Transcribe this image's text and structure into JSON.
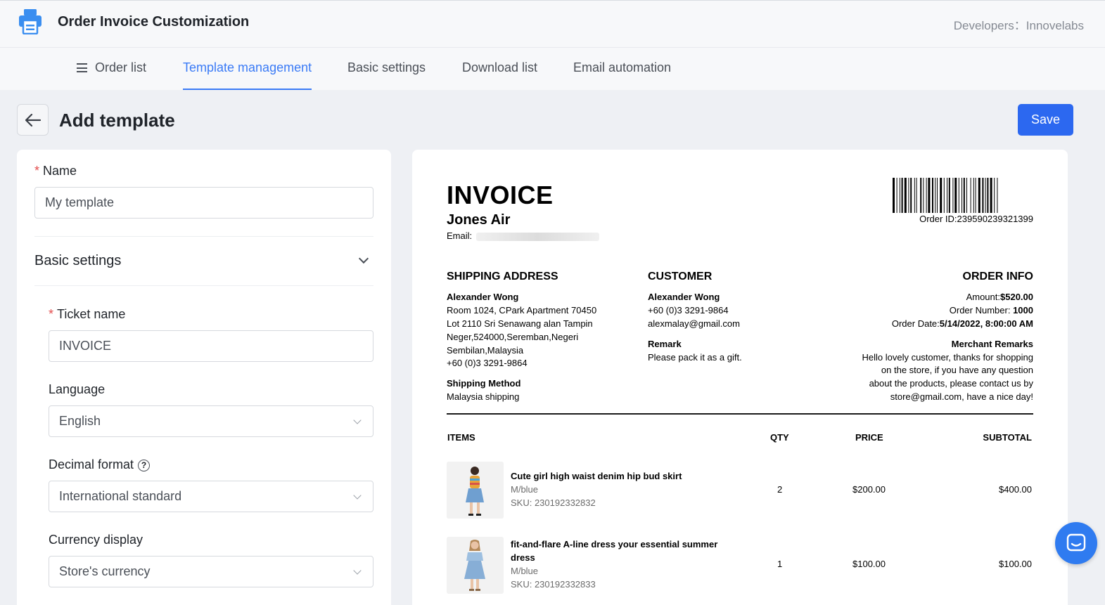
{
  "app": {
    "title": "Order Invoice Customization",
    "developer": "Developers：Innovelabs"
  },
  "nav": {
    "items": [
      {
        "label": "Order list"
      },
      {
        "label": "Template management"
      },
      {
        "label": "Basic settings"
      },
      {
        "label": "Download list"
      },
      {
        "label": "Email automation"
      }
    ],
    "active": "Template management"
  },
  "page": {
    "title": "Add template",
    "save_label": "Save"
  },
  "form": {
    "name_label": "Name",
    "name_value": "My template",
    "basic_settings_title": "Basic settings",
    "ticket_name_label": "Ticket name",
    "ticket_name_value": "INVOICE",
    "language_label": "Language",
    "language_value": "English",
    "decimal_label": "Decimal format",
    "decimal_value": "International standard",
    "currency_label": "Currency display",
    "currency_value": "Store's currency"
  },
  "invoice": {
    "title": "INVOICE",
    "company": "Jones Air",
    "email_label": "Email:",
    "order_id": "Order ID:239590239321399",
    "shipping": {
      "heading": "SHIPPING ADDRESS",
      "name": "Alexander Wong",
      "line1": "Room 1024, CPark Apartment 70450",
      "line2": "Lot 2110 Sri Senawang alan Tampin",
      "line3": "Neger,524000,Seremban,Negeri",
      "line4": "Sembilan,Malaysia",
      "phone": "+60 (0)3 3291-9864",
      "method_label": "Shipping Method",
      "method_value": "Malaysia shipping"
    },
    "customer": {
      "heading": "CUSTOMER",
      "name": "Alexander Wong",
      "phone": "+60 (0)3 3291-9864",
      "email": "alexmalay@gmail.com",
      "remark_label": "Remark",
      "remark_value": "Please pack it as a gift."
    },
    "order_info": {
      "heading": "ORDER INFO",
      "amount_label": "Amount:",
      "amount_value": "$520.00",
      "number_label": "Order Number: ",
      "number_value": "1000",
      "date_label": "Order Date:",
      "date_value": "5/14/2022, 8:00:00 AM",
      "merchant_label": "Merchant Remarks",
      "merchant_line1": "Hello lovely customer, thanks for shopping",
      "merchant_line2": "on the store, if you have any question",
      "merchant_line3": "about the products, please contact us by",
      "merchant_line4": "store@gmail.com, have a nice day!"
    },
    "table": {
      "h_items": "ITEMS",
      "h_qty": "QTY",
      "h_price": "PRICE",
      "h_subtotal": "SUBTOTAL",
      "rows": [
        {
          "name": "Cute girl high waist denim hip bud skirt",
          "variant": "M/blue",
          "sku": "SKU: 230192332832",
          "qty": "2",
          "price": "$200.00",
          "subtotal": "$400.00"
        },
        {
          "name1": "fit-and-flare A-line dress your essential summer",
          "name2": "dress",
          "variant": "M/blue",
          "sku": "SKU: 230192332833",
          "qty": "1",
          "price": "$100.00",
          "subtotal": "$100.00"
        }
      ]
    }
  },
  "colors": {
    "accent": "#3b7bf6",
    "save_button": "#2c68f0",
    "required": "#e34d4d"
  },
  "icons": [
    "printer-icon",
    "menu-icon",
    "back-arrow-icon",
    "chevron-down-icon",
    "help-icon",
    "barcode-icon",
    "chat-icon"
  ]
}
